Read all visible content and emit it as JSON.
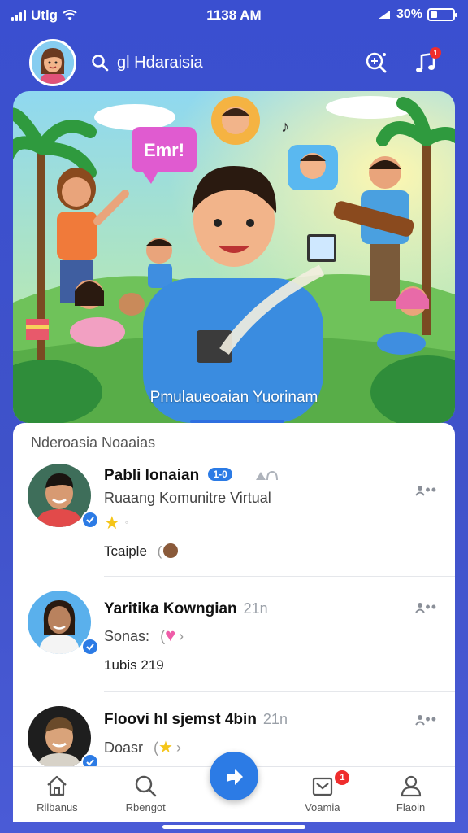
{
  "status_bar": {
    "carrier": "Utlg",
    "time": "1138 AM",
    "battery_text": "30%",
    "battery_level": 0.3
  },
  "header": {
    "search_placeholder": "gl Hdaraisia",
    "notification_count": "1"
  },
  "banner": {
    "speech_bubble": "Emr!",
    "caption": "Pmulaueoaian Yuorinam"
  },
  "feed": {
    "title": "Nderoasia Noaaias",
    "items": [
      {
        "name": "Pabli lonaian",
        "pill": "1-0",
        "meta": "",
        "line2": "Ruaang Komunitre Virtual",
        "line3": "Tcaiple",
        "more": "••"
      },
      {
        "name": "Yaritika Kowngian",
        "pill": "",
        "meta": "21n",
        "line2": "Sonas:",
        "line3": "1ubis  219",
        "more": "••"
      },
      {
        "name": "Floovi hl sjemst 4bin",
        "pill": "",
        "meta": "21n",
        "line2": "Doasr",
        "line3": "",
        "more": "••"
      }
    ]
  },
  "bottom_nav": {
    "items": [
      {
        "label": "Rilbanus",
        "icon": "home-icon"
      },
      {
        "label": "Rbengot",
        "icon": "search-icon"
      },
      {
        "label": "",
        "icon": "post-icon"
      },
      {
        "label": "Voamia",
        "icon": "inbox-icon",
        "badge": "1"
      },
      {
        "label": "Flaoin",
        "icon": "profile-icon"
      }
    ]
  },
  "colors": {
    "background": "#3a4fd0",
    "accent": "#2c7be5",
    "badge": "#ef2d2d"
  }
}
